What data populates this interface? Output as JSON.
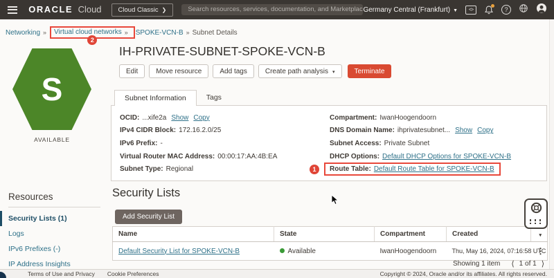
{
  "topbar": {
    "brand_bold": "ORACLE",
    "brand_light": "Cloud",
    "classic_button": "Cloud Classic",
    "search_placeholder": "Search resources, services, documentation, and Marketplace",
    "region": "Germany Central (Frankfurt)"
  },
  "breadcrumb": {
    "separator": "»",
    "items": [
      "Networking",
      "Virtual cloud networks",
      "SPOKE-VCN-B",
      "Subnet Details"
    ]
  },
  "annotations": {
    "badge1": "1",
    "badge2": "2"
  },
  "sidebar": {
    "hex_letter": "S",
    "status": "AVAILABLE",
    "resources_title": "Resources",
    "items": [
      {
        "label": "Security Lists (1)",
        "active": true
      },
      {
        "label": "Logs",
        "active": false
      },
      {
        "label": "IPv6 Prefixes (-)",
        "active": false
      },
      {
        "label": "IP Address Insights",
        "active": false
      }
    ]
  },
  "page": {
    "title": "IH-PRIVATE-SUBNET-SPOKE-VCN-B",
    "actions": [
      "Edit",
      "Move resource",
      "Add tags",
      "Create path analysis"
    ],
    "terminate_label": "Terminate",
    "tabs": [
      {
        "label": "Subnet Information",
        "active": true
      },
      {
        "label": "Tags",
        "active": false
      }
    ]
  },
  "subnet_info": {
    "left": [
      {
        "label": "OCID:",
        "value": "...xife2a",
        "links": [
          "Show",
          "Copy"
        ]
      },
      {
        "label": "IPv4 CIDR Block:",
        "value": "172.16.2.0/25"
      },
      {
        "label": "IPv6 Prefix:",
        "value": "-"
      },
      {
        "label": "Virtual Router MAC Address:",
        "value": "00:00:17:AA:4B:EA"
      },
      {
        "label": "Subnet Type:",
        "value": "Regional"
      }
    ],
    "right": [
      {
        "label": "Compartment:",
        "value": "IwanHoogendoorn"
      },
      {
        "label": "DNS Domain Name:",
        "value": "ihprivatesubnet...",
        "links": [
          "Show",
          "Copy"
        ]
      },
      {
        "label": "Subnet Access:",
        "value": "Private Subnet"
      },
      {
        "label": "DHCP Options:",
        "link_value": "Default DHCP Options for SPOKE-VCN-B"
      },
      {
        "label": "Route Table:",
        "link_value": "Default Route Table for SPOKE-VCN-B",
        "annotated": true
      }
    ]
  },
  "security_lists": {
    "title": "Security Lists",
    "add_button": "Add Security List",
    "columns": [
      "Name",
      "State",
      "Compartment",
      "Created"
    ],
    "rows": [
      {
        "name": "Default Security List for SPOKE-VCN-B",
        "state": "Available",
        "compartment": "IwanHoogendoorn",
        "created": "Thu, May 16, 2024, 07:16:58 UTC"
      }
    ],
    "showing": "Showing 1 item",
    "page_indicator": "1 of 1"
  },
  "footer": {
    "links": [
      "Terms of Use and Privacy",
      "Cookie Preferences"
    ],
    "copyright": "Copyright © 2024, Oracle and/or its affiliates. All rights reserved."
  },
  "colors": {
    "topbar_bg": "#3a3632",
    "link": "#2d7088",
    "annotation_red": "#e8473a",
    "hexagon_green": "#4c8628",
    "status_green": "#3a9a36",
    "terminate_red": "#d94a32"
  }
}
